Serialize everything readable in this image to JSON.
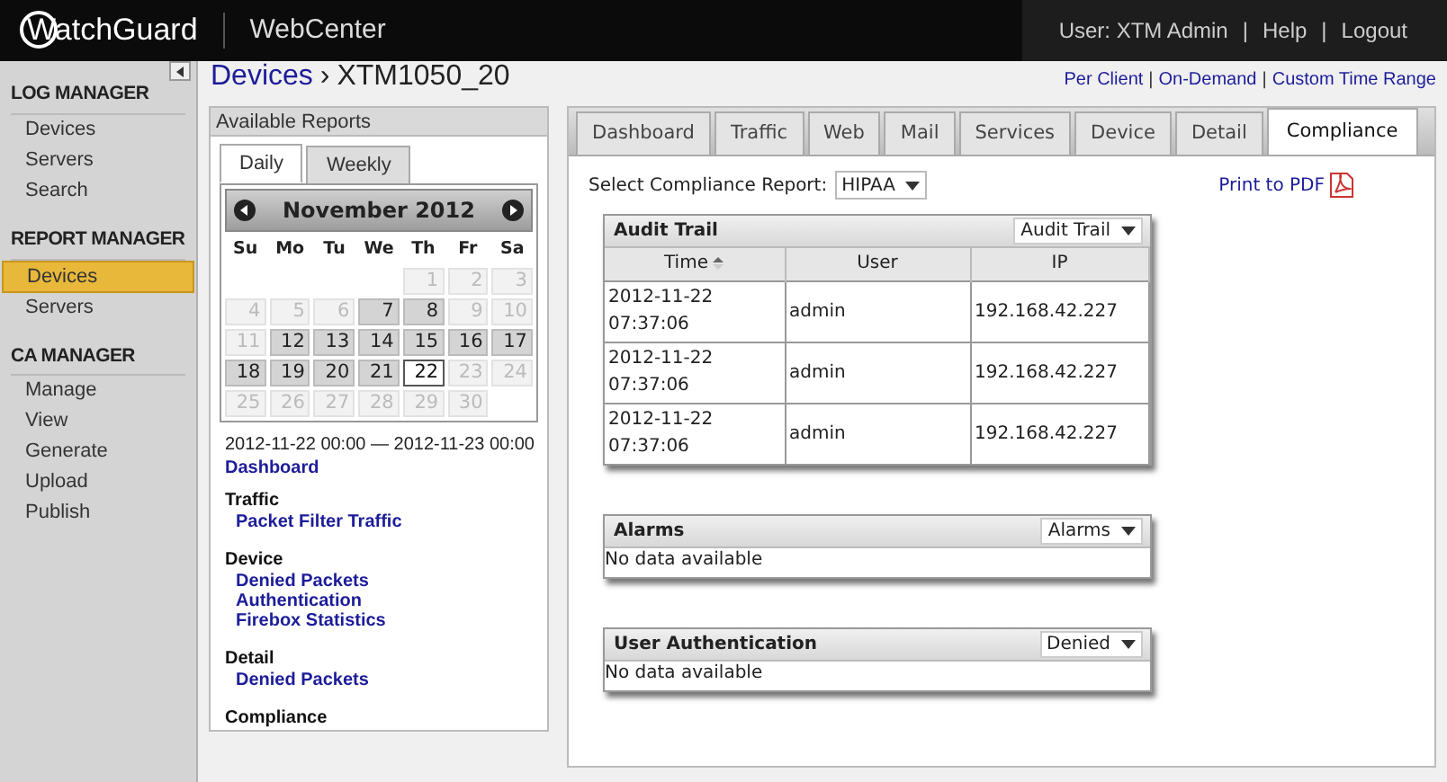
{
  "header": {
    "logo": "WatchGuard",
    "app": "WebCenter",
    "user": "User: XTM Admin",
    "separator": "|",
    "links": [
      "Help",
      "Logout"
    ]
  },
  "sidebar": {
    "sections": [
      {
        "title": "LOG MANAGER",
        "items": [
          {
            "label": "Devices",
            "selected": false
          },
          {
            "label": "Servers",
            "selected": false
          },
          {
            "label": "Search",
            "selected": false
          }
        ]
      },
      {
        "title": "REPORT MANAGER",
        "items": [
          {
            "label": "Devices",
            "selected": true
          },
          {
            "label": "Servers",
            "selected": false
          }
        ]
      },
      {
        "title": "CA MANAGER",
        "items": [
          {
            "label": "Manage",
            "selected": false
          },
          {
            "label": "View",
            "selected": false
          },
          {
            "label": "Generate",
            "selected": false
          },
          {
            "label": "Upload",
            "selected": false
          },
          {
            "label": "Publish",
            "selected": false
          }
        ]
      }
    ]
  },
  "breadcrumb": {
    "parent": "Devices",
    "separator": "›",
    "current": "XTM1050_20"
  },
  "time_links": {
    "separator": "|",
    "items": [
      "Per Client",
      "On-Demand",
      "Custom Time Range"
    ]
  },
  "reports_panel": {
    "title": "Available Reports",
    "tabs": [
      {
        "label": "Daily",
        "selected": true
      },
      {
        "label": "Weekly",
        "selected": false
      }
    ],
    "calendar": {
      "month": "November 2012",
      "weekdays": [
        "Su",
        "Mo",
        "Tu",
        "We",
        "Th",
        "Fr",
        "Sa"
      ],
      "weeks": [
        [
          {
            "kind": "blank"
          },
          {
            "kind": "blank"
          },
          {
            "kind": "blank"
          },
          {
            "kind": "blank"
          },
          {
            "day": "1",
            "available": false,
            "selected": false
          },
          {
            "day": "2",
            "available": false,
            "selected": false
          },
          {
            "day": "3",
            "available": false,
            "selected": false
          }
        ],
        [
          {
            "day": "4",
            "available": false,
            "selected": false
          },
          {
            "day": "5",
            "available": false,
            "selected": false
          },
          {
            "day": "6",
            "available": false,
            "selected": false
          },
          {
            "day": "7",
            "available": true,
            "selected": false
          },
          {
            "day": "8",
            "available": true,
            "selected": false
          },
          {
            "day": "9",
            "available": false,
            "selected": false
          },
          {
            "day": "10",
            "available": false,
            "selected": false
          }
        ],
        [
          {
            "day": "11",
            "available": false,
            "selected": false
          },
          {
            "day": "12",
            "available": true,
            "selected": false
          },
          {
            "day": "13",
            "available": true,
            "selected": false
          },
          {
            "day": "14",
            "available": true,
            "selected": false
          },
          {
            "day": "15",
            "available": true,
            "selected": false
          },
          {
            "day": "16",
            "available": true,
            "selected": false
          },
          {
            "day": "17",
            "available": true,
            "selected": false
          }
        ],
        [
          {
            "day": "18",
            "available": true,
            "selected": false
          },
          {
            "day": "19",
            "available": true,
            "selected": false
          },
          {
            "day": "20",
            "available": true,
            "selected": false
          },
          {
            "day": "21",
            "available": true,
            "selected": false
          },
          {
            "day": "22",
            "available": true,
            "selected": true
          },
          {
            "day": "23",
            "available": false,
            "selected": false
          },
          {
            "day": "24",
            "available": false,
            "selected": false
          }
        ],
        [
          {
            "day": "25",
            "available": false,
            "selected": false
          },
          {
            "day": "26",
            "available": false,
            "selected": false
          },
          {
            "day": "27",
            "available": false,
            "selected": false
          },
          {
            "day": "28",
            "available": false,
            "selected": false
          },
          {
            "day": "29",
            "available": false,
            "selected": false
          },
          {
            "day": "30",
            "available": false,
            "selected": false
          },
          {
            "kind": "blank"
          }
        ]
      ]
    },
    "range": "2012-11-22 00:00 — 2012-11-23 00:00",
    "items": [
      {
        "kind": "link",
        "label": "Dashboard"
      },
      {
        "kind": "group",
        "title": "Traffic",
        "links": [
          "Packet Filter Traffic"
        ]
      },
      {
        "kind": "group",
        "title": "Device",
        "links": [
          "Denied Packets",
          "Authentication",
          "Firebox Statistics"
        ]
      },
      {
        "kind": "group",
        "title": "Detail",
        "links": [
          "Denied Packets"
        ]
      },
      {
        "kind": "group",
        "title": "Compliance"
      }
    ]
  },
  "tabs": [
    {
      "label": "Dashboard",
      "selected": false
    },
    {
      "label": "Traffic",
      "selected": false
    },
    {
      "label": "Web",
      "selected": false
    },
    {
      "label": "Mail",
      "selected": false
    },
    {
      "label": "Services",
      "selected": false
    },
    {
      "label": "Device",
      "selected": false
    },
    {
      "label": "Detail",
      "selected": false
    },
    {
      "label": "Compliance",
      "selected": true
    }
  ],
  "compliance_select": {
    "label": "Select Compliance Report:",
    "value": "HIPAA"
  },
  "print_link": "Print to PDF",
  "widgets": [
    {
      "kind": "table",
      "title": "Audit Trail",
      "dropdown": "Audit Trail",
      "columns": [
        {
          "label": "Time",
          "sorted": true
        },
        {
          "label": "User",
          "sorted": false
        },
        {
          "label": "IP",
          "sorted": false
        }
      ],
      "rows": [
        [
          "2012-11-22 07:37:06",
          "admin",
          "192.168.42.227"
        ],
        [
          "2012-11-22 07:37:06",
          "admin",
          "192.168.42.227"
        ],
        [
          "2012-11-22 07:37:06",
          "admin",
          "192.168.42.227"
        ]
      ]
    },
    {
      "kind": "empty",
      "title": "Alarms",
      "dropdown": "Alarms",
      "message": "No data available"
    },
    {
      "kind": "empty",
      "title": "User Authentication",
      "dropdown": "Denied",
      "message": "No data available"
    }
  ]
}
